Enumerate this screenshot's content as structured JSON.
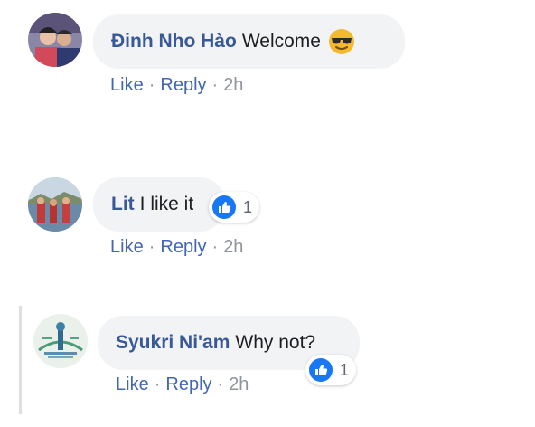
{
  "comments": [
    {
      "author": "Đinh Nho Hào",
      "text": "Welcome",
      "emoji": "sunglasses-emoji",
      "actions": {
        "like": "Like",
        "reply": "Reply",
        "time": "2h",
        "sep": "·"
      }
    },
    {
      "author": "Lit",
      "text": "I like it",
      "reactions": {
        "icon": "thumbs-up-icon",
        "count": "1"
      },
      "actions": {
        "like": "Like",
        "reply": "Reply",
        "time": "2h",
        "sep": "·"
      }
    },
    {
      "author": "Syukri Ni'am",
      "text": "Why not?",
      "reactions": {
        "icon": "thumbs-up-icon",
        "count": "1"
      },
      "actions": {
        "like": "Like",
        "reply": "Reply",
        "time": "2h",
        "sep": "·"
      }
    }
  ],
  "colors": {
    "author": "#385898",
    "link": "#4267b2",
    "meta": "#90949c",
    "bubble": "#f2f3f5",
    "like_blue": "#1877f2"
  }
}
